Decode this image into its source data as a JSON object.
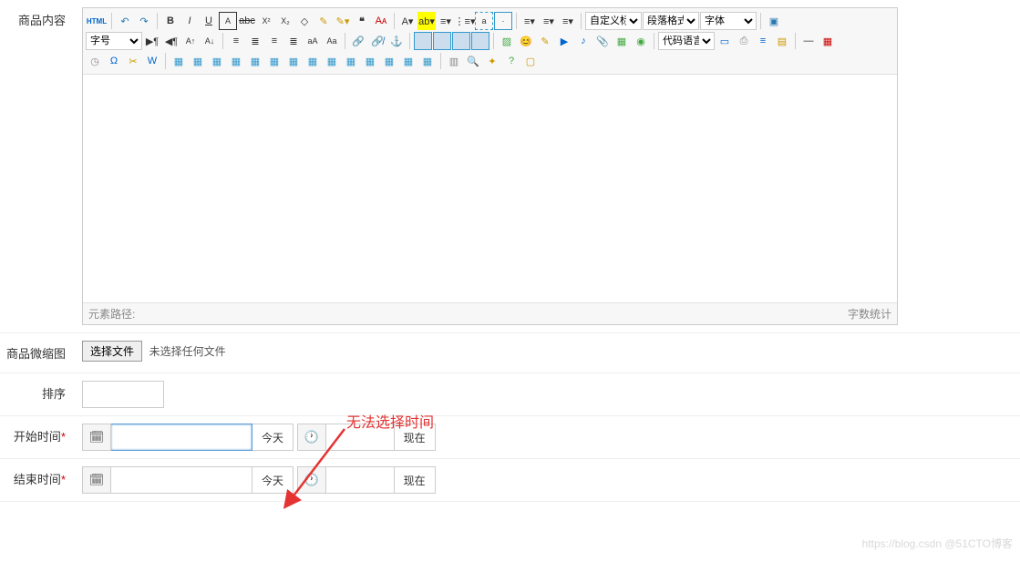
{
  "labels": {
    "content": "商品内容",
    "thumb": "商品微缩图",
    "sort": "排序",
    "start": "开始时间",
    "end": "结束时间"
  },
  "editor": {
    "selects": {
      "custom_icon": "自定义标",
      "para_format": "段落格式",
      "font_family": "字体",
      "font_size": "字号",
      "code_lang": "代码语言"
    },
    "footer": {
      "path": "元素路径:",
      "count": "字数统计"
    },
    "html_label": "HTML"
  },
  "file": {
    "button": "选择文件",
    "text": "未选择任何文件"
  },
  "dt": {
    "today": "今天",
    "now": "现在"
  },
  "start_value": "",
  "end_value": "",
  "annotation": "无法选择时间",
  "watermark": "https://blog.csdn @51CTO博客",
  "icons": {
    "undo": "↶",
    "redo": "↷",
    "bold": "B",
    "italic": "I",
    "underline": "U",
    "emoji": "😊",
    "calendar": "📅",
    "clock": "🕐"
  }
}
